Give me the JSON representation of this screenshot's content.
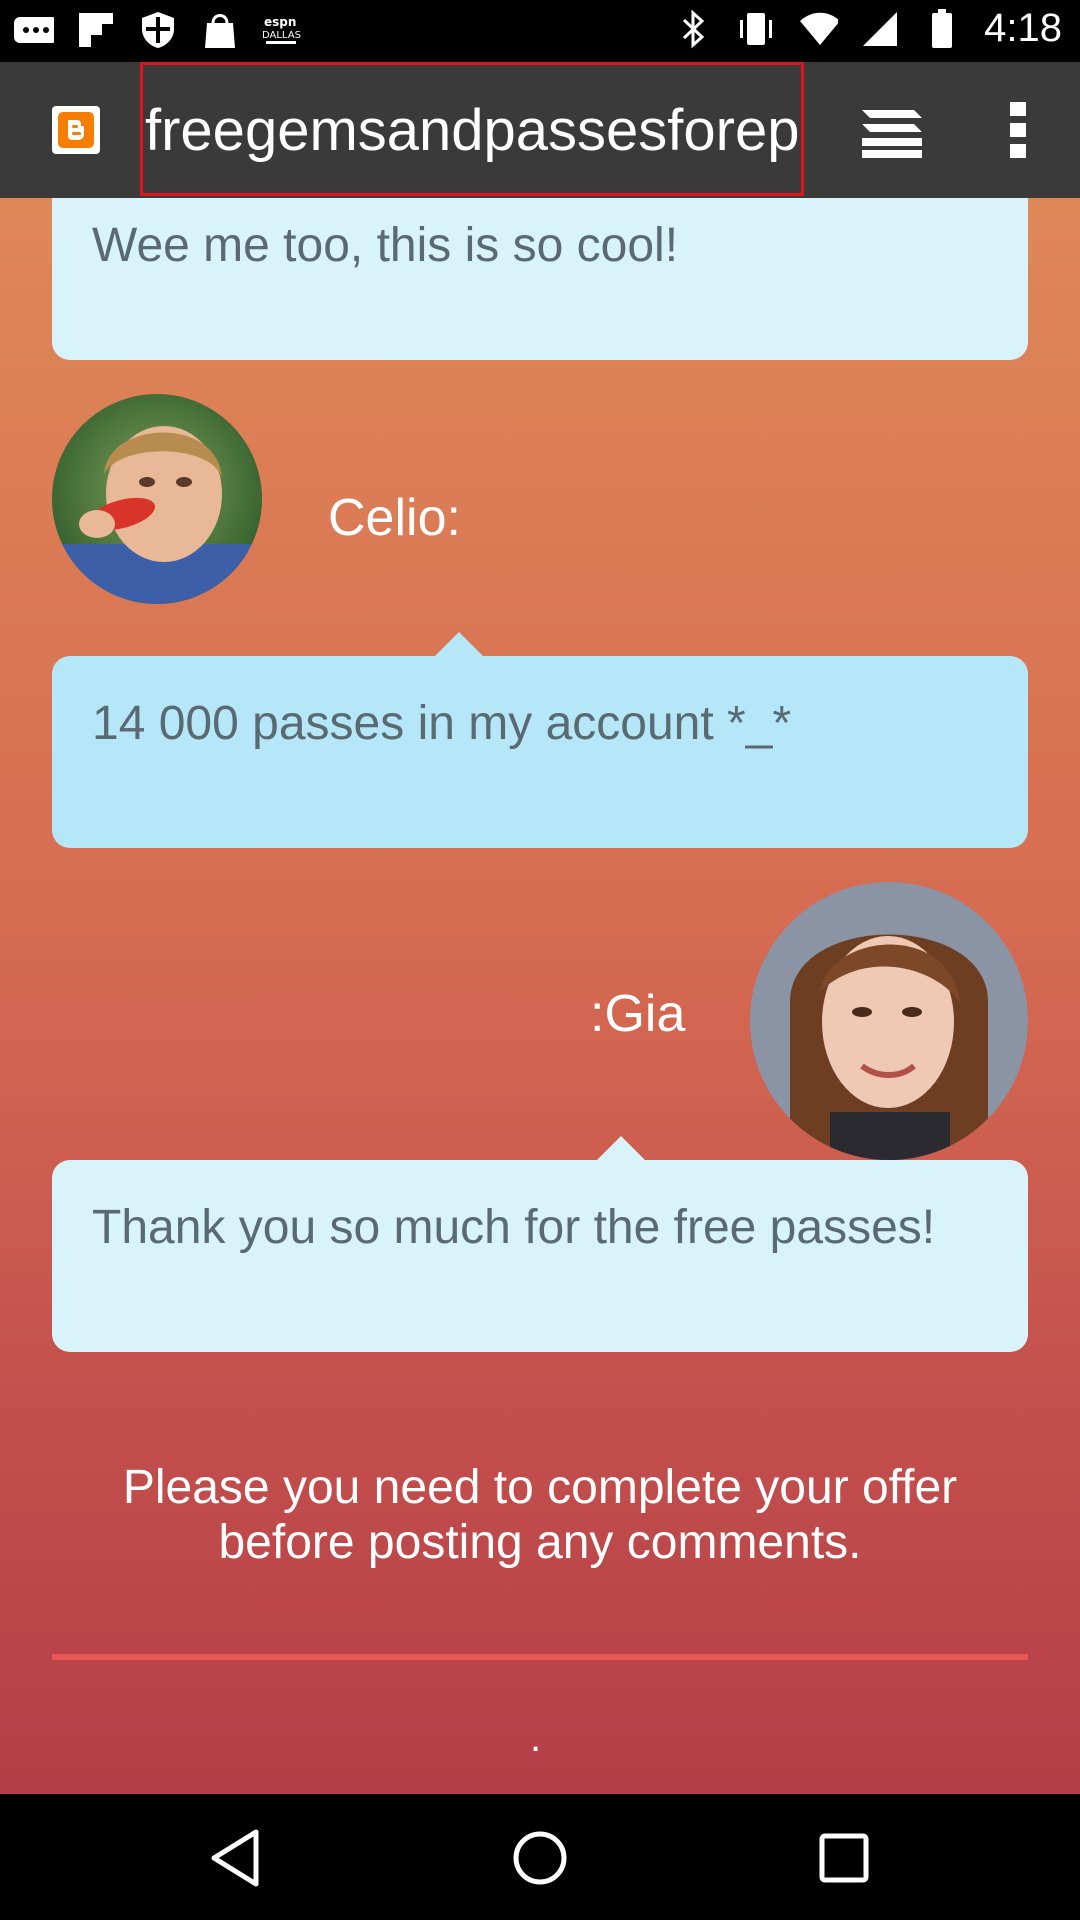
{
  "status_bar": {
    "time": "4:18",
    "left_icons": [
      "more-notifications-icon",
      "flipboard-icon",
      "shield-icon",
      "shopping-bag-icon",
      "espn-icon"
    ],
    "right_icons": [
      "bluetooth-icon",
      "vibrate-icon",
      "wifi-icon",
      "signal-icon",
      "battery-icon"
    ]
  },
  "app_bar": {
    "url": "freegemsandpassesforepisode",
    "icons": [
      "blogger-icon",
      "stack-menu-icon",
      "overflow-menu-icon"
    ]
  },
  "comments": [
    {
      "text": "Wee me too, this is so cool!"
    },
    {
      "author": "Celio:",
      "text": "14 000 passes in my account *_*"
    },
    {
      "author": ":Gia",
      "text": "Thank you so much for the free passes!"
    }
  ],
  "notice": {
    "line1": "Please you need to complete your offer",
    "line2": "before posting any comments."
  },
  "footer_dot": ".",
  "colors": {
    "bubble_light": "#d9f3fb",
    "bubble_blue": "#b5e7f9",
    "divider": "#e8585a",
    "url_highlight": "#e0141e"
  },
  "nav_bar": {
    "icons": [
      "back-icon",
      "home-icon",
      "recents-icon"
    ]
  }
}
